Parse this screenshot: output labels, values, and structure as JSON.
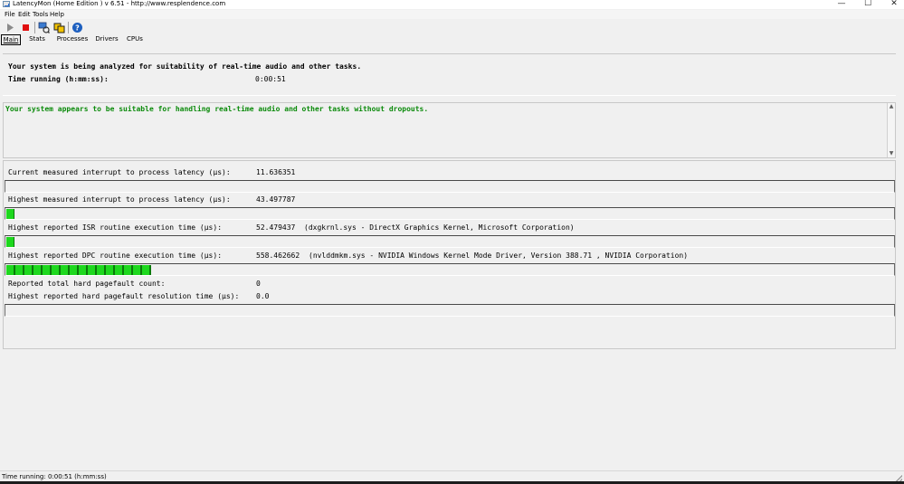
{
  "window": {
    "title": "LatencyMon  (Home Edition )  v 6.51 - http://www.resplendence.com",
    "minimize_glyph": "—",
    "maximize_glyph": "☐",
    "close_glyph": "✕"
  },
  "menu": [
    "File",
    "Edit",
    "Tools",
    "Help"
  ],
  "toolbar": {
    "icons": [
      "play-icon",
      "stop-icon",
      "analyze-icon",
      "report-icon",
      "help-icon"
    ],
    "stop_color": "#e01010",
    "help_color": "#1d5fbf"
  },
  "tabs": [
    "Main",
    "Stats",
    "Processes",
    "Drivers",
    "CPUs"
  ],
  "active_tab": "Main",
  "header": {
    "line1": "Your system is being analyzed for suitability of real-time audio and other tasks.",
    "time_label": "Time running (h:mm:ss):",
    "time_value": "0:00:51"
  },
  "conclusion": {
    "text": "Your system appears to be suitable for handling real-time audio and other tasks without dropouts.",
    "color": "#0a8a0a"
  },
  "metrics": [
    {
      "label": "Current measured interrupt to process latency (µs):",
      "value": "11.636351",
      "detail": "",
      "fill": 0.0
    },
    {
      "label": "Highest measured interrupt to process latency (µs):",
      "value": "43.497787",
      "detail": "",
      "fill": 0.009
    },
    {
      "label": "Highest reported ISR routine execution time (µs):",
      "value": "52.479437",
      "detail": "(dxgkrnl.sys - DirectX Graphics Kernel, Microsoft Corporation)",
      "fill": 0.009
    },
    {
      "label": "Highest reported DPC routine execution time (µs):",
      "value": "558.462662",
      "detail": "(nvlddmkm.sys - NVIDIA Windows Kernel Mode Driver, Version 388.71 , NVIDIA Corporation)",
      "fill": 0.163
    },
    {
      "label": "Reported total hard pagefault count:",
      "value": "0",
      "detail": ""
    },
    {
      "label": "Highest reported hard pagefault resolution time (µs):",
      "value": "0.0",
      "detail": "",
      "fill": 0.0
    }
  ],
  "status": {
    "text": "Time running: 0:00:51  (h:mm:ss)"
  }
}
